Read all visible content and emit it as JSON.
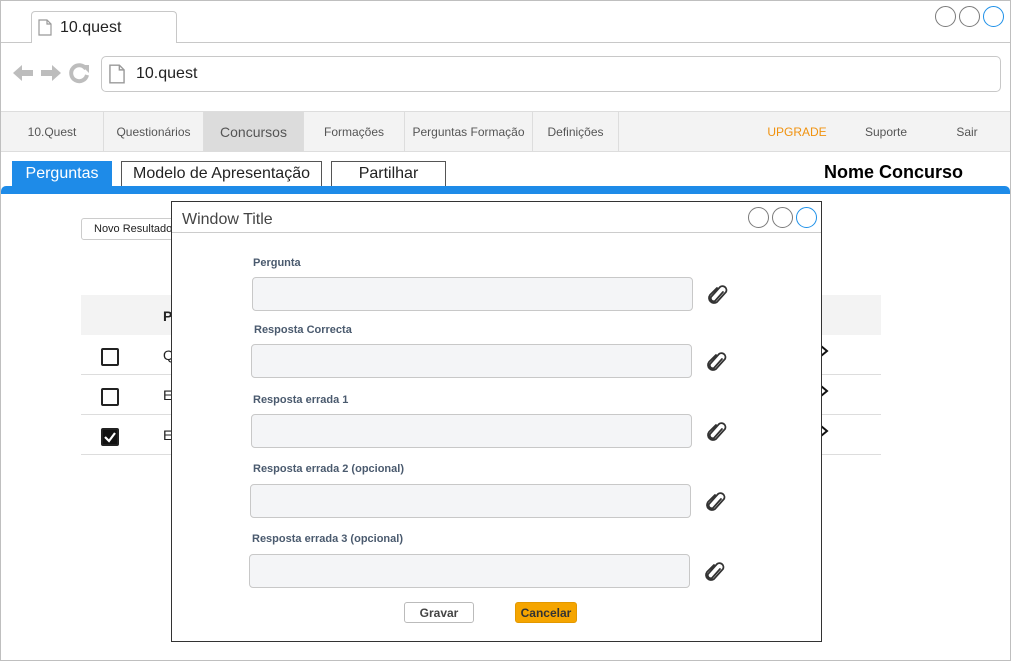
{
  "browser": {
    "tab_title": "10.quest",
    "url": "10.quest"
  },
  "menu": {
    "items": [
      "10.Quest",
      "Questionários",
      "Concursos",
      "Formações",
      "Perguntas Formação",
      "Definições"
    ],
    "active": "Concursos",
    "right_items": [
      "UPGRADE",
      "Suporte",
      "Sair"
    ],
    "upgrade_color": "#f0920f"
  },
  "page_tabs": {
    "items": [
      "Perguntas",
      "Modelo de Apresentação",
      "Partilhar"
    ],
    "active": "Perguntas"
  },
  "page_title": "Nome Concurso",
  "accent_color": "#1e8be8",
  "background": {
    "novo_button": "Novo Resultado",
    "table_header": "P",
    "rows": [
      {
        "text": "Q",
        "checked": false
      },
      {
        "text": "E",
        "checked": false
      },
      {
        "text": "E",
        "checked": true
      }
    ]
  },
  "modal": {
    "title": "Window Title",
    "fields": [
      {
        "label": "Pergunta",
        "value": ""
      },
      {
        "label": "Resposta Correcta",
        "value": ""
      },
      {
        "label": "Resposta errada 1",
        "value": ""
      },
      {
        "label": "Resposta errada 2 (opcional)",
        "value": ""
      },
      {
        "label": "Resposta errada 3 (opcional)",
        "value": ""
      }
    ],
    "attach_icon": "paperclip-icon",
    "save_label": "Gravar",
    "cancel_label": "Cancelar",
    "cancel_color": "#f5a500"
  }
}
